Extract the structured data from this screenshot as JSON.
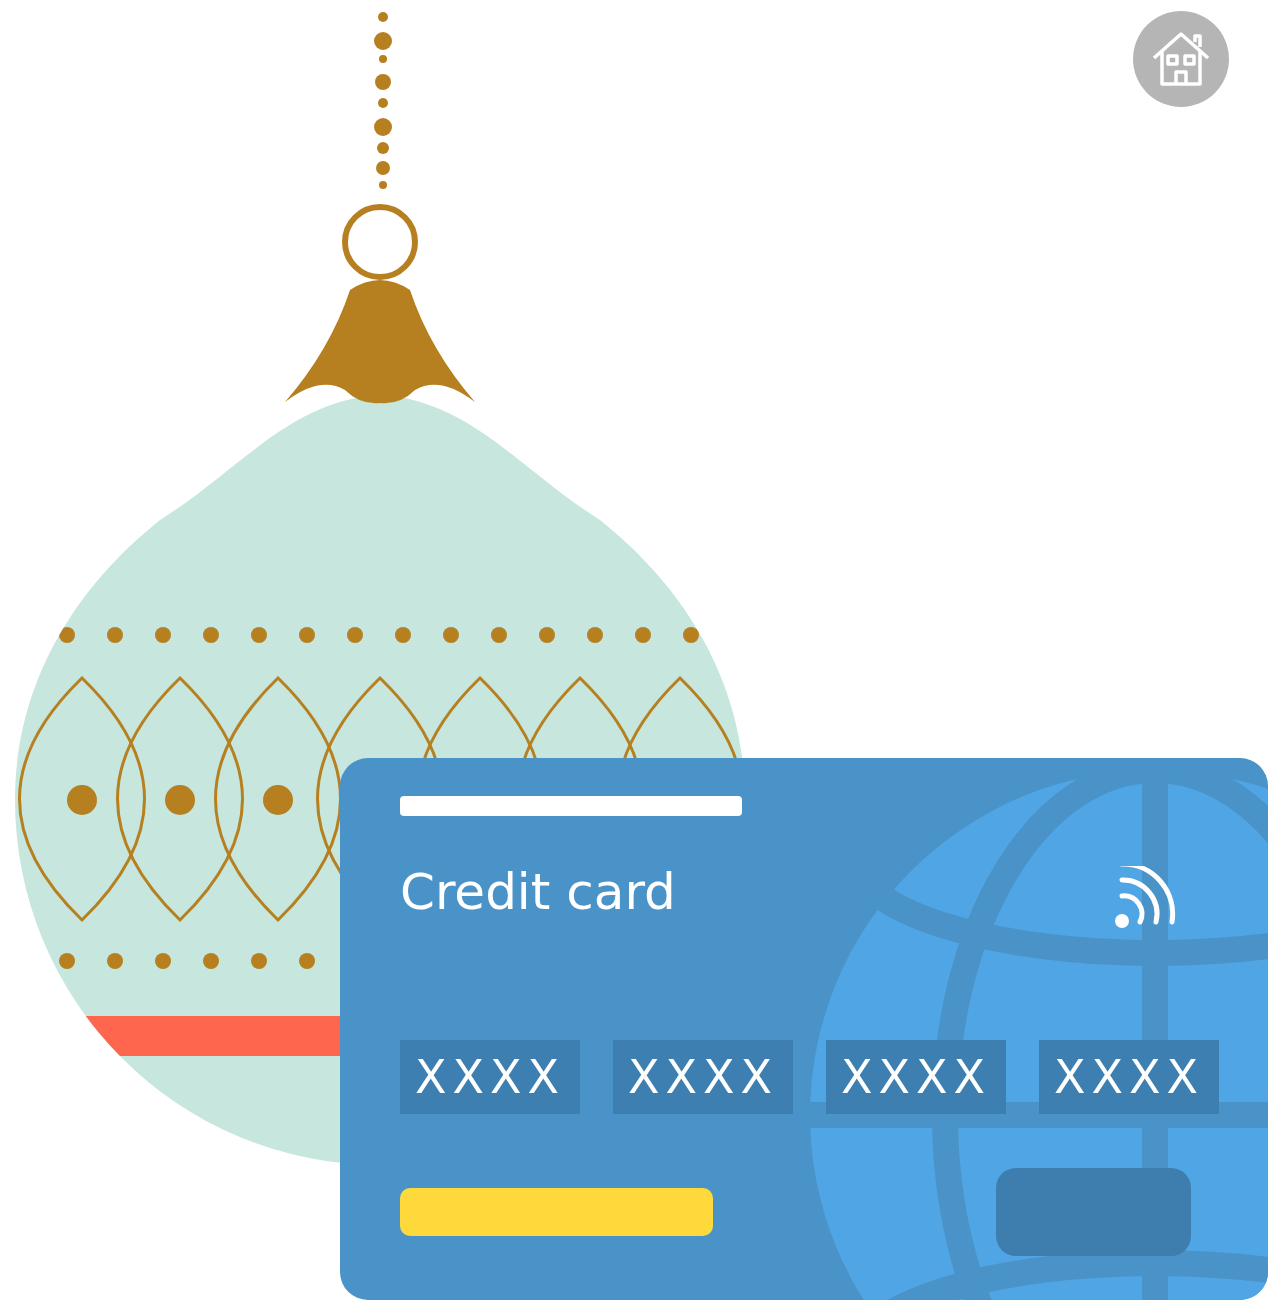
{
  "card": {
    "title": "Credit card",
    "number_groups": [
      "XXXX",
      "XXXX",
      "XXXX",
      "XXXX"
    ]
  }
}
